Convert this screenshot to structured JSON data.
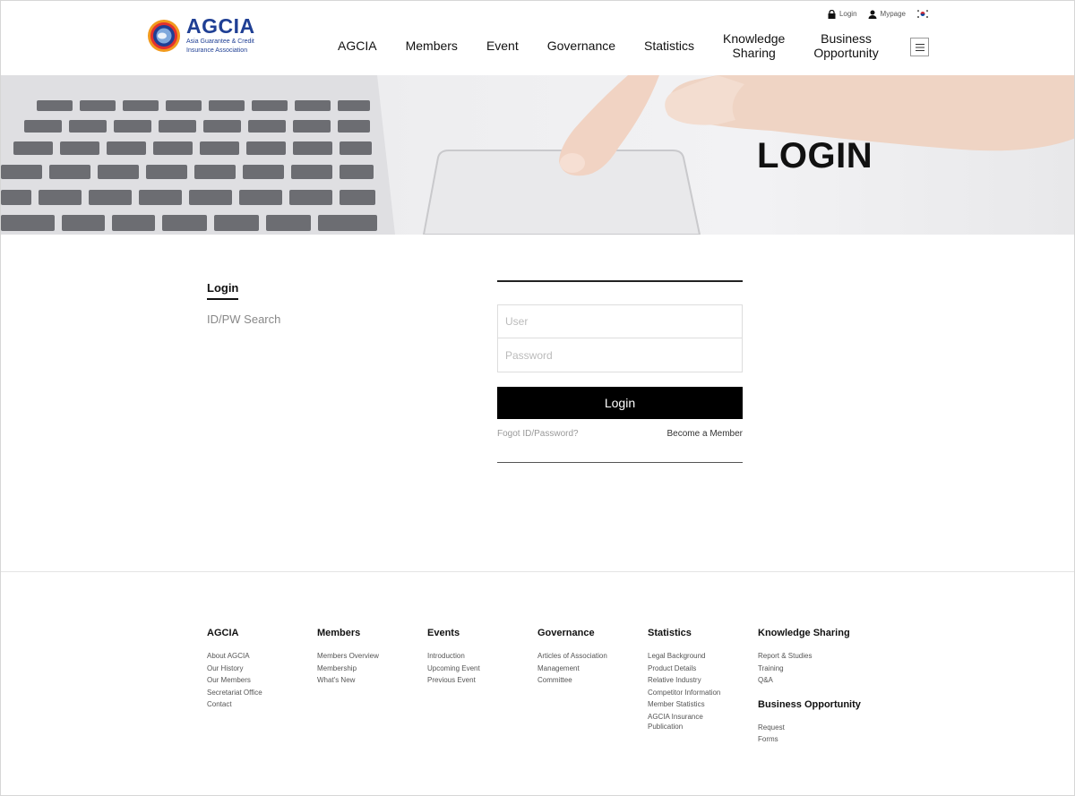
{
  "header": {
    "logo_title": "AGCIA",
    "logo_sub_1": "Asia Guarantee & Credit",
    "logo_sub_2": "Insurance Association",
    "util": {
      "login": "Login",
      "mypage": "Mypage"
    },
    "nav": [
      {
        "line1": "AGCIA",
        "line2": ""
      },
      {
        "line1": "Members",
        "line2": ""
      },
      {
        "line1": "Event",
        "line2": ""
      },
      {
        "line1": "Governance",
        "line2": ""
      },
      {
        "line1": "Statistics",
        "line2": ""
      },
      {
        "line1": "Knowledge",
        "line2": "Sharing"
      },
      {
        "line1": "Business",
        "line2": "Opportunity"
      }
    ]
  },
  "banner": {
    "title": "LOGIN"
  },
  "sidebar": {
    "active": "Login",
    "item": "ID/PW Search"
  },
  "form": {
    "user_placeholder": "User",
    "password_placeholder": "Password",
    "login_button": "Login",
    "forgot": "Fogot ID/Password?",
    "become": "Become a Member"
  },
  "footer": {
    "cols": [
      {
        "title": "AGCIA",
        "links": [
          "About AGCIA",
          "Our History",
          "Our Members",
          "Secretariat Office",
          "Contact"
        ]
      },
      {
        "title": "Members",
        "links": [
          "Members Overview",
          "Membership",
          "What's New"
        ]
      },
      {
        "title": "Events",
        "links": [
          "Introduction",
          "Upcoming Event",
          "Previous Event"
        ]
      },
      {
        "title": "Governance",
        "links": [
          "Articles of Association",
          "Management",
          "Committee"
        ]
      },
      {
        "title": "Statistics",
        "links": [
          "Legal Background",
          "Product Details",
          "Relative Industry",
          "Competitor Information",
          "Member Statistics",
          "AGCIA Insurance",
          "Publication"
        ]
      },
      {
        "title": "Knowledge Sharing",
        "links": [
          "Report & Studies",
          "Training",
          "Q&A"
        ]
      }
    ],
    "extra": {
      "title": "Business Opportunity",
      "links": [
        "Request",
        "Forms"
      ]
    }
  }
}
